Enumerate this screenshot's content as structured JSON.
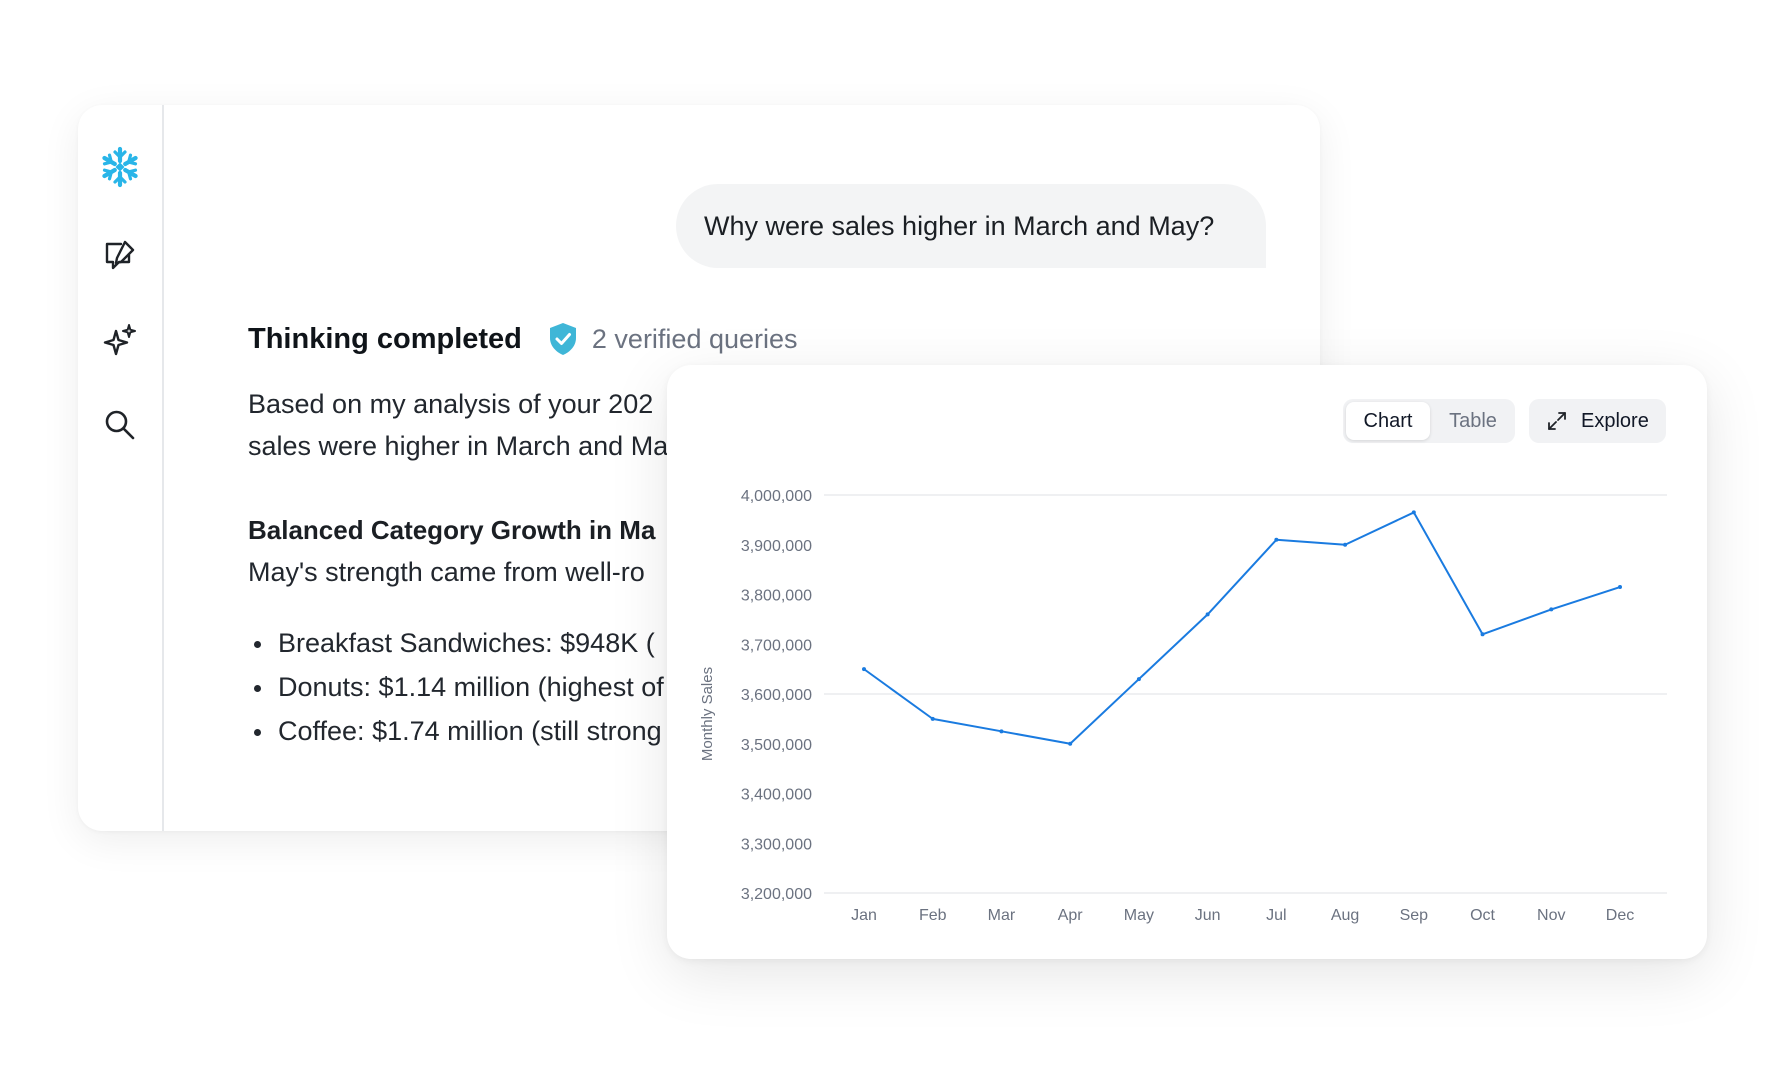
{
  "sidebar": {
    "items": [
      {
        "icon": "snowflake-logo-icon",
        "color": "#29b5e8"
      },
      {
        "icon": "new-chat-icon"
      },
      {
        "icon": "sparkle-icon"
      },
      {
        "icon": "search-icon"
      }
    ]
  },
  "chat": {
    "user_message": "Why were sales higher in March and May?",
    "thinking_title": "Thinking completed",
    "verified_text": "2 verified queries",
    "verified_color": "#3fb6d7",
    "paragraph_lines": [
      "Based on my analysis of your 202",
      "sales were higher in March and Ma"
    ],
    "section_title": "Balanced Category Growth in Ma",
    "section_text": "May's strength came from well-ro",
    "bullets": [
      "Breakfast Sandwiches: $948K (",
      "Donuts: $1.14 million (highest of",
      "Coffee: $1.74 million (still strong"
    ]
  },
  "chart_panel": {
    "tabs": [
      {
        "label": "Chart",
        "active": true
      },
      {
        "label": "Table",
        "active": false
      }
    ],
    "explore_label": "Explore"
  },
  "chart_data": {
    "type": "line",
    "categories": [
      "Jan",
      "Feb",
      "Mar",
      "Apr",
      "May",
      "Jun",
      "Jul",
      "Aug",
      "Sep",
      "Oct",
      "Nov",
      "Dec"
    ],
    "series": [
      {
        "values": [
          3650000,
          3550000,
          3525000,
          3500000,
          3630000,
          3760000,
          3910000,
          3900000,
          3965000,
          3720000,
          3770000,
          3815000
        ],
        "color": "#1a7be0"
      }
    ],
    "ylabel": "Monthly Sales",
    "xlabel": "",
    "ylim": [
      3200000,
      4000000
    ],
    "yticks": [
      "4,000,000",
      "3,900,000",
      "3,800,000",
      "3,700,000",
      "3,600,000",
      "3,500,000",
      "3,400,000",
      "3,300,000",
      "3,200,000"
    ],
    "grid": true
  }
}
